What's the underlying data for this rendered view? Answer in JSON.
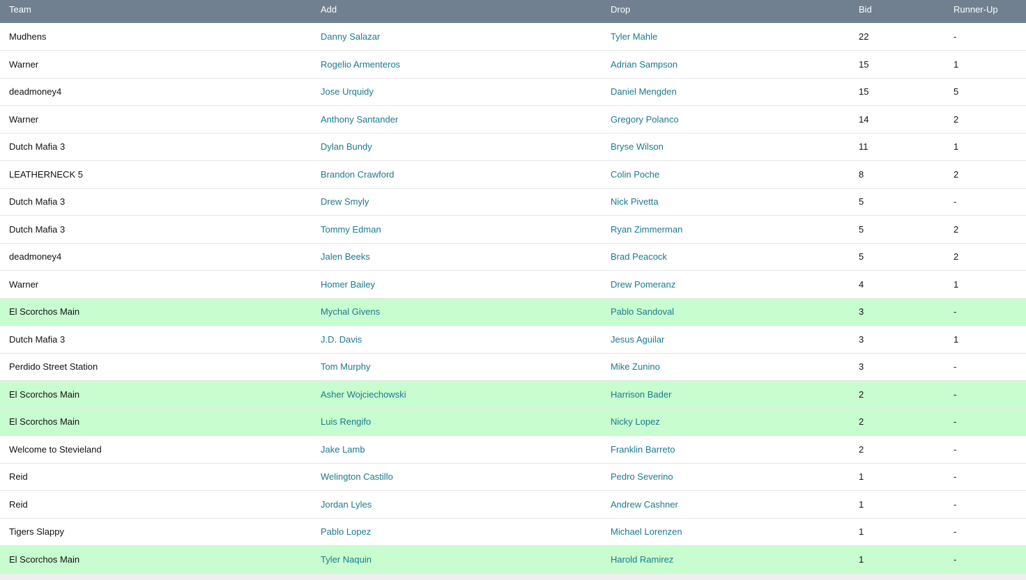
{
  "columns": {
    "team": "Team",
    "add": "Add",
    "drop": "Drop",
    "bid": "Bid",
    "runner_up": "Runner-Up"
  },
  "colors": {
    "header_bg": "#708090",
    "highlight_bg": "#c8fdd0",
    "link": "#1b7a8c"
  },
  "rows": [
    {
      "team": "Mudhens",
      "add": "Danny Salazar",
      "drop": "Tyler Mahle",
      "bid": "22",
      "runner_up": "-",
      "highlight": false
    },
    {
      "team": "Warner",
      "add": "Rogelio Armenteros",
      "drop": "Adrian Sampson",
      "bid": "15",
      "runner_up": "1",
      "highlight": false
    },
    {
      "team": "deadmoney4",
      "add": "Jose Urquidy",
      "drop": "Daniel Mengden",
      "bid": "15",
      "runner_up": "5",
      "highlight": false
    },
    {
      "team": "Warner",
      "add": "Anthony Santander",
      "drop": "Gregory Polanco",
      "bid": "14",
      "runner_up": "2",
      "highlight": false
    },
    {
      "team": "Dutch Mafia 3",
      "add": "Dylan Bundy",
      "drop": "Bryse Wilson",
      "bid": "11",
      "runner_up": "1",
      "highlight": false
    },
    {
      "team": "LEATHERNECK 5",
      "add": "Brandon Crawford",
      "drop": "Colin Poche",
      "bid": "8",
      "runner_up": "2",
      "highlight": false
    },
    {
      "team": "Dutch Mafia 3",
      "add": "Drew Smyly",
      "drop": "Nick Pivetta",
      "bid": "5",
      "runner_up": "-",
      "highlight": false
    },
    {
      "team": "Dutch Mafia 3",
      "add": "Tommy Edman",
      "drop": "Ryan Zimmerman",
      "bid": "5",
      "runner_up": "2",
      "highlight": false
    },
    {
      "team": "deadmoney4",
      "add": "Jalen Beeks",
      "drop": "Brad Peacock",
      "bid": "5",
      "runner_up": "2",
      "highlight": false
    },
    {
      "team": "Warner",
      "add": "Homer Bailey",
      "drop": "Drew Pomeranz",
      "bid": "4",
      "runner_up": "1",
      "highlight": false
    },
    {
      "team": "El Scorchos Main",
      "add": "Mychal Givens",
      "drop": "Pablo Sandoval",
      "bid": "3",
      "runner_up": "-",
      "highlight": true
    },
    {
      "team": "Dutch Mafia 3",
      "add": "J.D. Davis",
      "drop": "Jesus Aguilar",
      "bid": "3",
      "runner_up": "1",
      "highlight": false
    },
    {
      "team": "Perdido Street Station",
      "add": "Tom Murphy",
      "drop": "Mike Zunino",
      "bid": "3",
      "runner_up": "-",
      "highlight": false
    },
    {
      "team": "El Scorchos Main",
      "add": "Asher Wojciechowski",
      "drop": "Harrison Bader",
      "bid": "2",
      "runner_up": "-",
      "highlight": true
    },
    {
      "team": "El Scorchos Main",
      "add": "Luis Rengifo",
      "drop": "Nicky Lopez",
      "bid": "2",
      "runner_up": "-",
      "highlight": true
    },
    {
      "team": "Welcome to Stevieland",
      "add": "Jake Lamb",
      "drop": "Franklin Barreto",
      "bid": "2",
      "runner_up": "-",
      "highlight": false
    },
    {
      "team": "Reid",
      "add": "Welington Castillo",
      "drop": "Pedro Severino",
      "bid": "1",
      "runner_up": "-",
      "highlight": false
    },
    {
      "team": "Reid",
      "add": "Jordan Lyles",
      "drop": "Andrew Cashner",
      "bid": "1",
      "runner_up": "-",
      "highlight": false
    },
    {
      "team": "Tigers Slappy",
      "add": "Pablo Lopez",
      "drop": "Michael Lorenzen",
      "bid": "1",
      "runner_up": "-",
      "highlight": false
    },
    {
      "team": "El Scorchos Main",
      "add": "Tyler Naquin",
      "drop": "Harold Ramirez",
      "bid": "1",
      "runner_up": "-",
      "highlight": true
    }
  ]
}
